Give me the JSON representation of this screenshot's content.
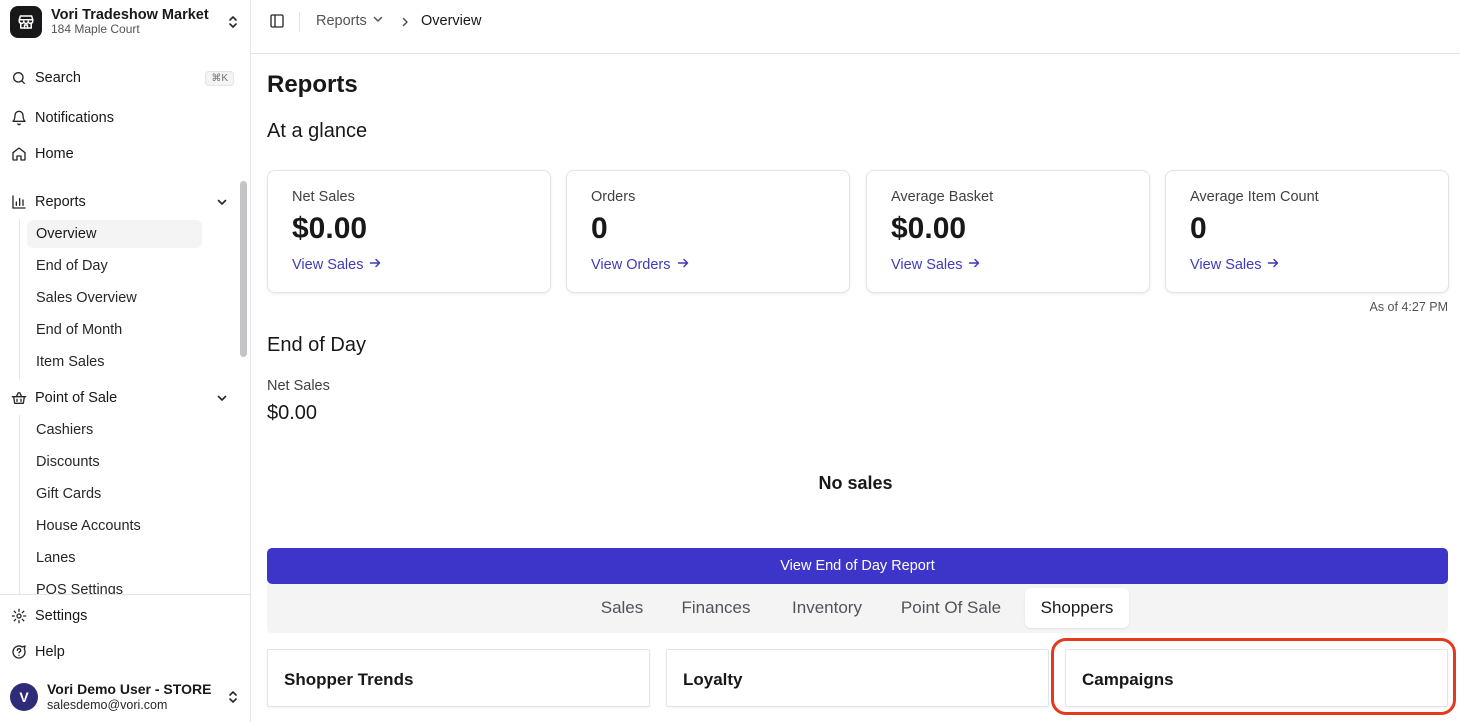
{
  "store": {
    "name": "Vori Tradeshow Market",
    "address": "184 Maple Court"
  },
  "sidebar": {
    "search": {
      "label": "Search",
      "shortcut": "⌘K"
    },
    "notifications": "Notifications",
    "home": "Home",
    "reports": {
      "label": "Reports",
      "items": [
        "Overview",
        "End of Day",
        "Sales Overview",
        "End of Month",
        "Item Sales"
      ],
      "active": "Overview"
    },
    "pos": {
      "label": "Point of Sale",
      "items": [
        "Cashiers",
        "Discounts",
        "Gift Cards",
        "House Accounts",
        "Lanes",
        "POS Settings"
      ]
    },
    "settings": "Settings",
    "help": "Help",
    "user": {
      "initial": "V",
      "name": "Vori Demo User - STORE",
      "email": "salesdemo@vori.com"
    }
  },
  "breadcrumb": {
    "parent": "Reports",
    "current": "Overview"
  },
  "page": {
    "title": "Reports",
    "glance_title": "At a glance",
    "stats": [
      {
        "label": "Net Sales",
        "value": "$0.00",
        "link": "View Sales"
      },
      {
        "label": "Orders",
        "value": "0",
        "link": "View Orders"
      },
      {
        "label": "Average Basket",
        "value": "$0.00",
        "link": "View Sales"
      },
      {
        "label": "Average Item Count",
        "value": "0",
        "link": "View Sales"
      }
    ],
    "as_of": "As of 4:27 PM",
    "eod": {
      "title": "End of Day",
      "net_sales_label": "Net Sales",
      "net_sales_value": "$0.00",
      "empty": "No sales",
      "button": "View End of Day Report"
    },
    "tabs": [
      "Sales",
      "Finances",
      "Inventory",
      "Point Of Sale",
      "Shoppers"
    ],
    "active_tab": "Shoppers",
    "report_cards": [
      "Shopper Trends",
      "Loyalty",
      "Campaigns"
    ]
  },
  "colors": {
    "accent": "#3d35c9",
    "link": "#3f3bb8",
    "highlight": "#e5391d",
    "avatar": "#2e2c78"
  }
}
